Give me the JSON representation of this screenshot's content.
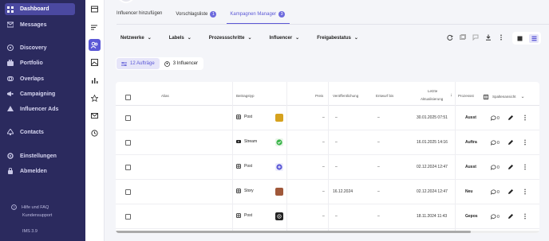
{
  "sidebar": {
    "items": [
      {
        "label": "Dashboard",
        "icon": "dashboard-icon"
      },
      {
        "label": "Messages",
        "icon": "messages-icon"
      },
      {
        "label": "Discovery",
        "icon": "discovery-icon"
      },
      {
        "label": "Portfolio",
        "icon": "portfolio-icon"
      },
      {
        "label": "Overlaps",
        "icon": "overlaps-icon"
      },
      {
        "label": "Campaigning",
        "icon": "campaigning-icon"
      },
      {
        "label": "Influencer Ads",
        "icon": "influencer-ads-icon"
      },
      {
        "label": "Contacts",
        "icon": "contacts-icon"
      },
      {
        "label": "Einstellungen",
        "icon": "settings-icon"
      },
      {
        "label": "Abmelden",
        "icon": "logout-icon"
      }
    ],
    "footer": {
      "help": "Hilfe und FAQ",
      "support": "Kundensupport",
      "version": "IMS 3.9"
    }
  },
  "tabs": [
    {
      "label": "Influencer hinzufügen",
      "badge": ""
    },
    {
      "label": "Vorschlagsliste",
      "badge": "1"
    },
    {
      "label": "Kampagnen Manager",
      "badge": "3"
    }
  ],
  "filters": [
    "Netzwerke",
    "Labels",
    "Prozessschritte",
    "Influencer",
    "Freigabestatus"
  ],
  "segments": {
    "orders": "12 Aufträge",
    "influencers": "3 Influencer"
  },
  "table": {
    "headers": {
      "alias": "Alias",
      "type": "Beitragstyp",
      "price": "Preis",
      "published": "Veröffentlichung",
      "draft": "Entwurf bis",
      "updated_1": "Letzte",
      "updated_2": "Aktualisierung",
      "process": "Prozessst",
      "columns": "Spaltenansicht"
    },
    "rows": [
      {
        "type": "Post",
        "price": "–",
        "published": "–",
        "draft": "–",
        "updated": "30.01.2025 07:51",
        "status": "Ausst",
        "comments": "0"
      },
      {
        "type": "Stream",
        "price": "–",
        "published": "–",
        "draft": "–",
        "updated": "16.01.2025 14:16",
        "status": "Auftra",
        "comments": "0"
      },
      {
        "type": "Post",
        "price": "–",
        "published": "–",
        "draft": "–",
        "updated": "02.12.2024 12:47",
        "status": "Ausst",
        "comments": "0"
      },
      {
        "type": "Story",
        "price": "–",
        "published": "16.12.2024",
        "draft": "–",
        "updated": "02.12.2024 12:47",
        "status": "Neu",
        "comments": "0"
      },
      {
        "type": "Post",
        "price": "–",
        "published": "–",
        "draft": "–",
        "updated": "18.11.2024 11:43",
        "status": "Gepos",
        "comments": "0"
      }
    ]
  },
  "colors": {
    "sidebar_bg": "#2b2a5e",
    "accent": "#5b58d6"
  }
}
